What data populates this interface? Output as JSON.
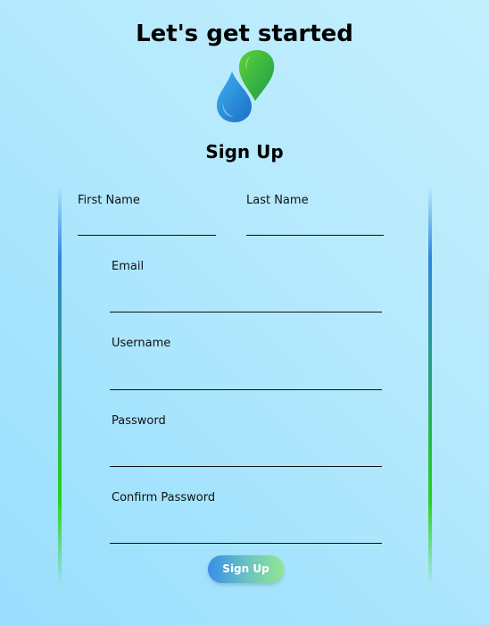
{
  "page": {
    "title": "Let's get started",
    "logo_icon": "water-drop-logo-icon",
    "colors": {
      "background_light": "#c4effd",
      "background_dark": "#99ddfd",
      "drop_blue": "#1e88d6",
      "drop_green": "#2db34a",
      "bar_blue": "#2f86e0",
      "bar_green": "#27d11a"
    }
  },
  "form": {
    "heading": "Sign Up",
    "fields": {
      "first_name": {
        "label": "First Name",
        "value": ""
      },
      "last_name": {
        "label": "Last Name",
        "value": ""
      },
      "email": {
        "label": "Email",
        "value": ""
      },
      "username": {
        "label": "Username",
        "value": ""
      },
      "password": {
        "label": "Password",
        "value": ""
      },
      "confirm_password": {
        "label": "Confirm Password",
        "value": ""
      }
    },
    "submit_label": "Sign Up"
  }
}
